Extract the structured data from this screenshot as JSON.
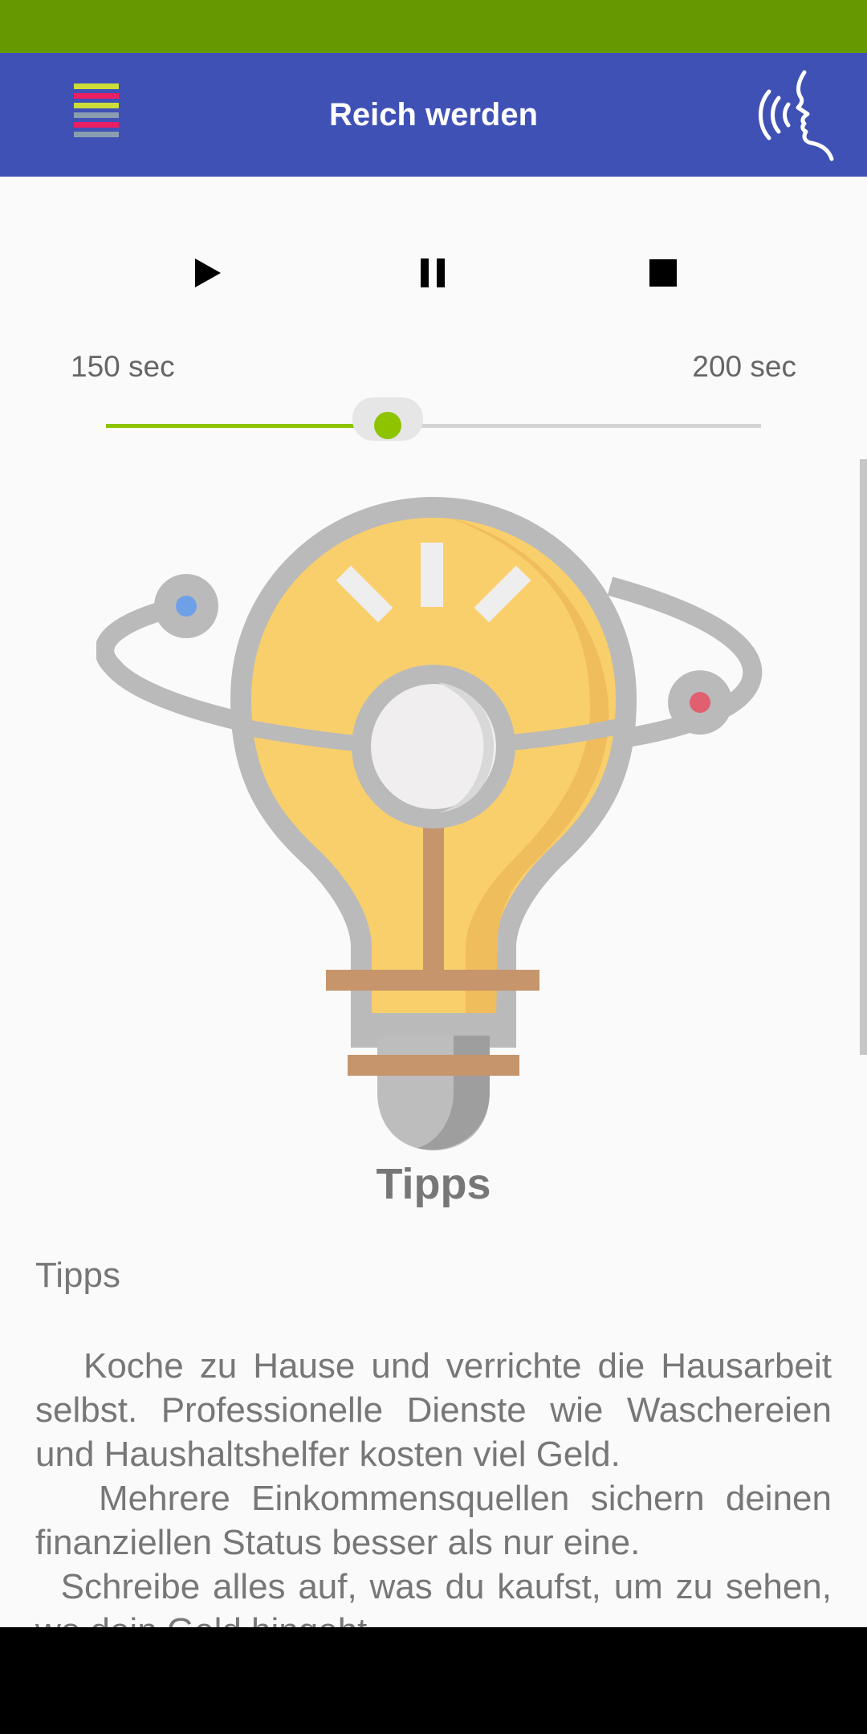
{
  "colors": {
    "status_bar": "#669900",
    "app_bar": "#3f51b5",
    "accent": "#8ec300",
    "text_muted": "#777777"
  },
  "app_bar": {
    "title": "Reich werden",
    "menu_icon": "menu-icon",
    "voice_icon": "speaking-head-icon"
  },
  "player": {
    "play_icon": "play-icon",
    "pause_icon": "pause-icon",
    "stop_icon": "stop-icon",
    "min_label": "150 sec",
    "max_label": "200 sec",
    "slider_value": 0.43
  },
  "illustration": {
    "icon": "lightbulb-icon"
  },
  "section": {
    "title": "Tipps"
  },
  "content": {
    "heading": "Tipps",
    "paragraphs": [
      "   Koche zu Hause und verrichte die Hausarbeit selbst. Professionelle Dienste wie Waschereien und Haushaltshelfer kosten viel Geld.",
      "   Mehrere Einkommensquellen sichern deinen finanziellen Status besser als nur eine.",
      "  Schreibe alles auf, was du kaufst, um zu sehen, wo dein Geld hingeht."
    ]
  }
}
